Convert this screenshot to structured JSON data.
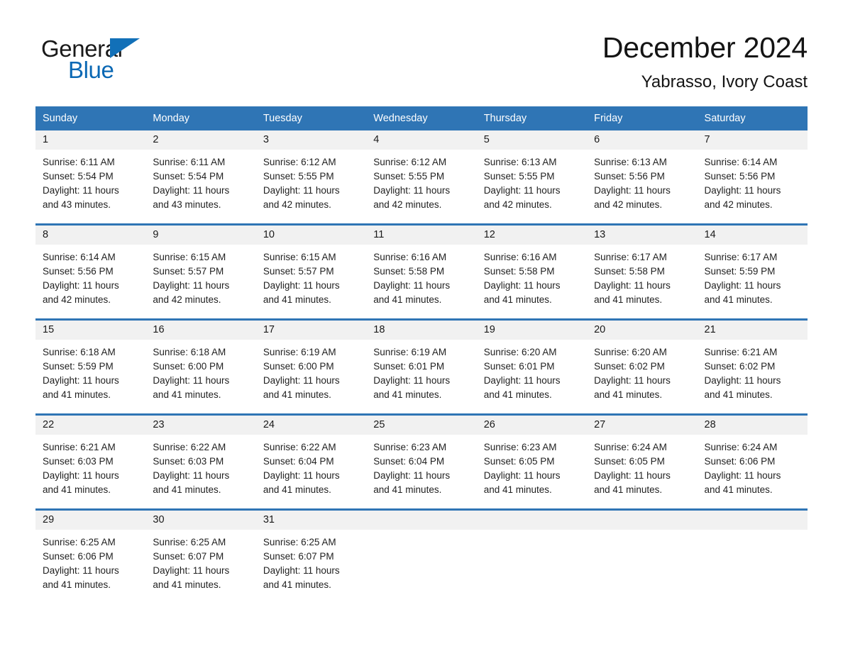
{
  "brand": {
    "name_part1": "General",
    "name_part2": "Blue",
    "logo_icon": "triangle-icon"
  },
  "header": {
    "month_title": "December 2024",
    "location": "Yabrasso, Ivory Coast"
  },
  "colors": {
    "accent_blue": "#2f75b5",
    "brand_blue": "#0a68b4",
    "daynum_band": "#f1f1f1",
    "text": "#1a1a1a"
  },
  "calendar": {
    "weekday_headers": [
      "Sunday",
      "Monday",
      "Tuesday",
      "Wednesday",
      "Thursday",
      "Friday",
      "Saturday"
    ],
    "weeks": [
      [
        {
          "day": "1",
          "sunrise": "Sunrise: 6:11 AM",
          "sunset": "Sunset: 5:54 PM",
          "daylight_line1": "Daylight: 11 hours",
          "daylight_line2": "and 43 minutes."
        },
        {
          "day": "2",
          "sunrise": "Sunrise: 6:11 AM",
          "sunset": "Sunset: 5:54 PM",
          "daylight_line1": "Daylight: 11 hours",
          "daylight_line2": "and 43 minutes."
        },
        {
          "day": "3",
          "sunrise": "Sunrise: 6:12 AM",
          "sunset": "Sunset: 5:55 PM",
          "daylight_line1": "Daylight: 11 hours",
          "daylight_line2": "and 42 minutes."
        },
        {
          "day": "4",
          "sunrise": "Sunrise: 6:12 AM",
          "sunset": "Sunset: 5:55 PM",
          "daylight_line1": "Daylight: 11 hours",
          "daylight_line2": "and 42 minutes."
        },
        {
          "day": "5",
          "sunrise": "Sunrise: 6:13 AM",
          "sunset": "Sunset: 5:55 PM",
          "daylight_line1": "Daylight: 11 hours",
          "daylight_line2": "and 42 minutes."
        },
        {
          "day": "6",
          "sunrise": "Sunrise: 6:13 AM",
          "sunset": "Sunset: 5:56 PM",
          "daylight_line1": "Daylight: 11 hours",
          "daylight_line2": "and 42 minutes."
        },
        {
          "day": "7",
          "sunrise": "Sunrise: 6:14 AM",
          "sunset": "Sunset: 5:56 PM",
          "daylight_line1": "Daylight: 11 hours",
          "daylight_line2": "and 42 minutes."
        }
      ],
      [
        {
          "day": "8",
          "sunrise": "Sunrise: 6:14 AM",
          "sunset": "Sunset: 5:56 PM",
          "daylight_line1": "Daylight: 11 hours",
          "daylight_line2": "and 42 minutes."
        },
        {
          "day": "9",
          "sunrise": "Sunrise: 6:15 AM",
          "sunset": "Sunset: 5:57 PM",
          "daylight_line1": "Daylight: 11 hours",
          "daylight_line2": "and 42 minutes."
        },
        {
          "day": "10",
          "sunrise": "Sunrise: 6:15 AM",
          "sunset": "Sunset: 5:57 PM",
          "daylight_line1": "Daylight: 11 hours",
          "daylight_line2": "and 41 minutes."
        },
        {
          "day": "11",
          "sunrise": "Sunrise: 6:16 AM",
          "sunset": "Sunset: 5:58 PM",
          "daylight_line1": "Daylight: 11 hours",
          "daylight_line2": "and 41 minutes."
        },
        {
          "day": "12",
          "sunrise": "Sunrise: 6:16 AM",
          "sunset": "Sunset: 5:58 PM",
          "daylight_line1": "Daylight: 11 hours",
          "daylight_line2": "and 41 minutes."
        },
        {
          "day": "13",
          "sunrise": "Sunrise: 6:17 AM",
          "sunset": "Sunset: 5:58 PM",
          "daylight_line1": "Daylight: 11 hours",
          "daylight_line2": "and 41 minutes."
        },
        {
          "day": "14",
          "sunrise": "Sunrise: 6:17 AM",
          "sunset": "Sunset: 5:59 PM",
          "daylight_line1": "Daylight: 11 hours",
          "daylight_line2": "and 41 minutes."
        }
      ],
      [
        {
          "day": "15",
          "sunrise": "Sunrise: 6:18 AM",
          "sunset": "Sunset: 5:59 PM",
          "daylight_line1": "Daylight: 11 hours",
          "daylight_line2": "and 41 minutes."
        },
        {
          "day": "16",
          "sunrise": "Sunrise: 6:18 AM",
          "sunset": "Sunset: 6:00 PM",
          "daylight_line1": "Daylight: 11 hours",
          "daylight_line2": "and 41 minutes."
        },
        {
          "day": "17",
          "sunrise": "Sunrise: 6:19 AM",
          "sunset": "Sunset: 6:00 PM",
          "daylight_line1": "Daylight: 11 hours",
          "daylight_line2": "and 41 minutes."
        },
        {
          "day": "18",
          "sunrise": "Sunrise: 6:19 AM",
          "sunset": "Sunset: 6:01 PM",
          "daylight_line1": "Daylight: 11 hours",
          "daylight_line2": "and 41 minutes."
        },
        {
          "day": "19",
          "sunrise": "Sunrise: 6:20 AM",
          "sunset": "Sunset: 6:01 PM",
          "daylight_line1": "Daylight: 11 hours",
          "daylight_line2": "and 41 minutes."
        },
        {
          "day": "20",
          "sunrise": "Sunrise: 6:20 AM",
          "sunset": "Sunset: 6:02 PM",
          "daylight_line1": "Daylight: 11 hours",
          "daylight_line2": "and 41 minutes."
        },
        {
          "day": "21",
          "sunrise": "Sunrise: 6:21 AM",
          "sunset": "Sunset: 6:02 PM",
          "daylight_line1": "Daylight: 11 hours",
          "daylight_line2": "and 41 minutes."
        }
      ],
      [
        {
          "day": "22",
          "sunrise": "Sunrise: 6:21 AM",
          "sunset": "Sunset: 6:03 PM",
          "daylight_line1": "Daylight: 11 hours",
          "daylight_line2": "and 41 minutes."
        },
        {
          "day": "23",
          "sunrise": "Sunrise: 6:22 AM",
          "sunset": "Sunset: 6:03 PM",
          "daylight_line1": "Daylight: 11 hours",
          "daylight_line2": "and 41 minutes."
        },
        {
          "day": "24",
          "sunrise": "Sunrise: 6:22 AM",
          "sunset": "Sunset: 6:04 PM",
          "daylight_line1": "Daylight: 11 hours",
          "daylight_line2": "and 41 minutes."
        },
        {
          "day": "25",
          "sunrise": "Sunrise: 6:23 AM",
          "sunset": "Sunset: 6:04 PM",
          "daylight_line1": "Daylight: 11 hours",
          "daylight_line2": "and 41 minutes."
        },
        {
          "day": "26",
          "sunrise": "Sunrise: 6:23 AM",
          "sunset": "Sunset: 6:05 PM",
          "daylight_line1": "Daylight: 11 hours",
          "daylight_line2": "and 41 minutes."
        },
        {
          "day": "27",
          "sunrise": "Sunrise: 6:24 AM",
          "sunset": "Sunset: 6:05 PM",
          "daylight_line1": "Daylight: 11 hours",
          "daylight_line2": "and 41 minutes."
        },
        {
          "day": "28",
          "sunrise": "Sunrise: 6:24 AM",
          "sunset": "Sunset: 6:06 PM",
          "daylight_line1": "Daylight: 11 hours",
          "daylight_line2": "and 41 minutes."
        }
      ],
      [
        {
          "day": "29",
          "sunrise": "Sunrise: 6:25 AM",
          "sunset": "Sunset: 6:06 PM",
          "daylight_line1": "Daylight: 11 hours",
          "daylight_line2": "and 41 minutes."
        },
        {
          "day": "30",
          "sunrise": "Sunrise: 6:25 AM",
          "sunset": "Sunset: 6:07 PM",
          "daylight_line1": "Daylight: 11 hours",
          "daylight_line2": "and 41 minutes."
        },
        {
          "day": "31",
          "sunrise": "Sunrise: 6:25 AM",
          "sunset": "Sunset: 6:07 PM",
          "daylight_line1": "Daylight: 11 hours",
          "daylight_line2": "and 41 minutes."
        },
        {
          "day": "",
          "sunrise": "",
          "sunset": "",
          "daylight_line1": "",
          "daylight_line2": ""
        },
        {
          "day": "",
          "sunrise": "",
          "sunset": "",
          "daylight_line1": "",
          "daylight_line2": ""
        },
        {
          "day": "",
          "sunrise": "",
          "sunset": "",
          "daylight_line1": "",
          "daylight_line2": ""
        },
        {
          "day": "",
          "sunrise": "",
          "sunset": "",
          "daylight_line1": "",
          "daylight_line2": ""
        }
      ]
    ]
  }
}
